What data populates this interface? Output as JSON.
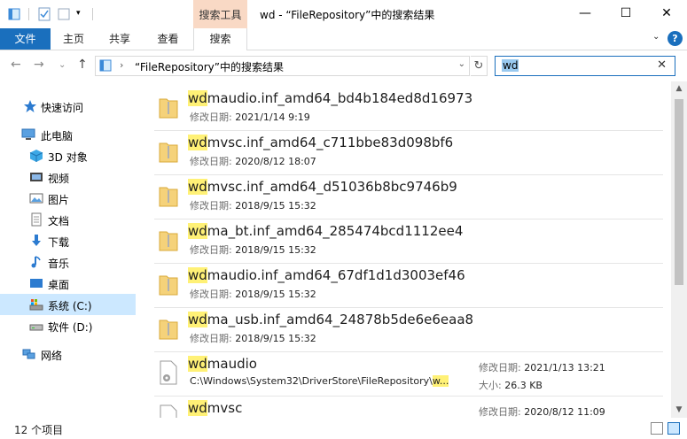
{
  "window": {
    "title": "wd - “FileRepository”中的搜索结果",
    "context_tab_title": "搜索工具",
    "minimize": "—",
    "maximize": "☐",
    "close": "✕"
  },
  "ribbon": {
    "tabs": [
      {
        "label": "文件"
      },
      {
        "label": "主页"
      },
      {
        "label": "共享"
      },
      {
        "label": "查看"
      },
      {
        "label": "搜索"
      }
    ],
    "collapse_glyph": "⌄",
    "help_glyph": "?"
  },
  "address": {
    "path": "“FileRepository”中的搜索结果",
    "separator": "›",
    "dropdown": "⌄",
    "refresh": "↻",
    "back": "←",
    "forward": "→",
    "recent": "⌄",
    "up": "↑"
  },
  "search": {
    "query": "wd",
    "clear": "✕"
  },
  "nav": {
    "items": [
      {
        "label": "快速访问",
        "icon": "star-icon"
      },
      {
        "label": "此电脑",
        "icon": "computer-icon"
      },
      {
        "label": "3D 对象",
        "icon": "3d-objects-icon"
      },
      {
        "label": "视频",
        "icon": "video-icon"
      },
      {
        "label": "图片",
        "icon": "pictures-icon"
      },
      {
        "label": "文档",
        "icon": "documents-icon"
      },
      {
        "label": "下载",
        "icon": "download-icon"
      },
      {
        "label": "音乐",
        "icon": "music-icon"
      },
      {
        "label": "桌面",
        "icon": "desktop-icon"
      },
      {
        "label": "系统 (C:)",
        "icon": "system-drive-icon",
        "selected": true
      },
      {
        "label": "软件 (D:)",
        "icon": "drive-icon"
      },
      {
        "label": "网络",
        "icon": "network-icon"
      }
    ]
  },
  "results": {
    "highlight": "wd",
    "date_label": "修改日期: ",
    "size_label": "大小: ",
    "items": [
      {
        "rest": "maudio.inf_amd64_bd4b184ed8d16973",
        "date": "2021/1/14 9:19"
      },
      {
        "rest": "mvsc.inf_amd64_c711bbe83d098bf6",
        "date": "2020/8/12 18:07"
      },
      {
        "rest": "mvsc.inf_amd64_d51036b8bc9746b9",
        "date": "2018/9/15 15:32"
      },
      {
        "rest": "ma_bt.inf_amd64_285474bcd1112ee4",
        "date": "2018/9/15 15:32"
      },
      {
        "rest": "maudio.inf_amd64_67df1d1d3003ef46",
        "date": "2018/9/15 15:32"
      },
      {
        "rest": "ma_usb.inf_amd64_24878b5de6e6eaa8",
        "date": "2018/9/15 15:32"
      }
    ],
    "files": [
      {
        "rest": "maudio",
        "path_prefix": "C:\\Windows\\System32\\DriverStore\\FileRepository\\",
        "path_hl": "w...",
        "date": "2021/1/13 13:21",
        "size": "26.3 KB"
      },
      {
        "rest": "mvsc",
        "date": "2020/8/12 11:09"
      }
    ]
  },
  "status": {
    "count": "12 个项目"
  }
}
